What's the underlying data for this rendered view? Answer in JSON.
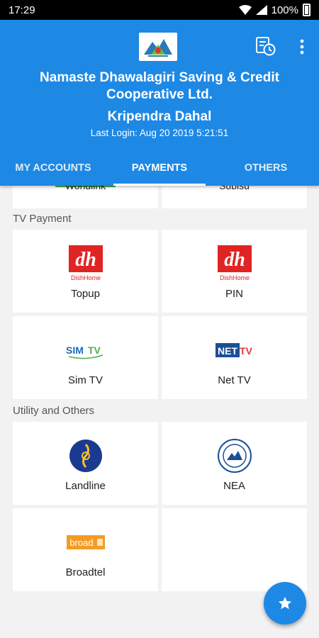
{
  "status_bar": {
    "time": "17:29",
    "battery": "100%"
  },
  "header": {
    "bank_name": "Namaste Dhawalagiri Saving & Credit Cooperative Ltd.",
    "user_name": "Kripendra Dahal",
    "last_login": "Last Login: Aug 20 2019  5:21:51"
  },
  "tabs": [
    {
      "label": "MY ACCOUNTS"
    },
    {
      "label": "PAYMENTS"
    },
    {
      "label": "OTHERS"
    }
  ],
  "active_tab": "PAYMENTS",
  "peek_items": [
    {
      "label": "Worldlink"
    },
    {
      "label": "Subisu"
    }
  ],
  "sections": [
    {
      "title": "TV Payment",
      "items": [
        {
          "label": "Topup",
          "icon": "dishhome-icon"
        },
        {
          "label": "PIN",
          "icon": "dishhome-icon"
        },
        {
          "label": "Sim TV",
          "icon": "simtv-icon"
        },
        {
          "label": "Net TV",
          "icon": "nettv-icon"
        }
      ]
    },
    {
      "title": "Utility and Others",
      "items": [
        {
          "label": "Landline",
          "icon": "ntc-icon"
        },
        {
          "label": "NEA",
          "icon": "nea-icon"
        },
        {
          "label": "Broadtel",
          "icon": "broadtel-icon"
        }
      ]
    }
  ],
  "logo_texts": {
    "dishhome": "DishHome",
    "simtv_sim": "SIM",
    "simtv_tv": "TV",
    "nettv_net": "NET",
    "nettv_tv": "TV",
    "broadtel": "broad"
  },
  "colors": {
    "primary": "#1e88e5",
    "dishhome_red": "#e02424",
    "broadtel_orange": "#f39c24"
  }
}
